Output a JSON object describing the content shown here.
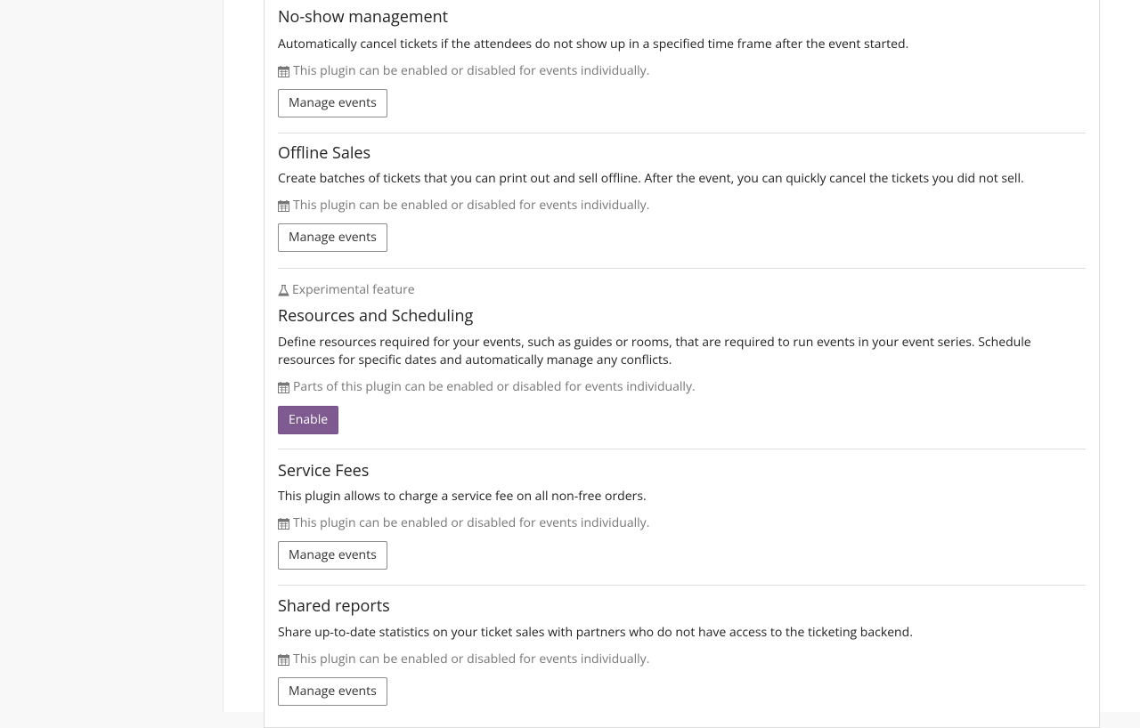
{
  "plugins": [
    {
      "title": "No-show management",
      "description": "Automatically cancel tickets if the attendees do not show up in a specified time frame after the event started.",
      "note": "This plugin can be enabled or disabled for events individually.",
      "button": "Manage events"
    },
    {
      "title": "Offline Sales",
      "description": "Create batches of tickets that you can print out and sell offline. After the event, you can quickly cancel the tickets you did not sell.",
      "note": "This plugin can be enabled or disabled for events individually.",
      "button": "Manage events"
    },
    {
      "experimental": "Experimental feature",
      "title": "Resources and Scheduling",
      "description": "Define resources required for your events, such as guides or rooms, that are required to run events in your event series. Schedule resources for specific dates and automatically manage any conflicts.",
      "note": "Parts of this plugin can be enabled or disabled for events individually.",
      "button": "Enable"
    },
    {
      "title": "Service Fees",
      "description": "This plugin allows to charge a service fee on all non-free orders.",
      "note": "This plugin can be enabled or disabled for events individually.",
      "button": "Manage events"
    },
    {
      "title": "Shared reports",
      "description": "Share up-to-date statistics on your ticket sales with partners who do not have access to the ticketing backend.",
      "note": "This plugin can be enabled or disabled for events individually.",
      "button": "Manage events"
    }
  ],
  "colors": {
    "primary": "#7f5a91",
    "muted": "#777777",
    "border": "#dddddd"
  }
}
